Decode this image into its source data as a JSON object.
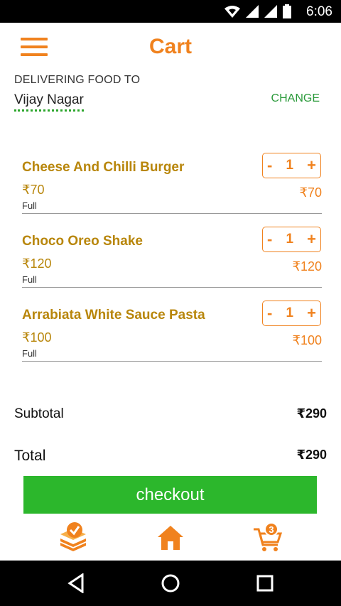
{
  "status_bar": {
    "time": "6:06"
  },
  "header": {
    "title": "Cart"
  },
  "delivery": {
    "label": "DELIVERING FOOD TO",
    "location": "Vijay Nagar",
    "change_label": "CHANGE"
  },
  "cart": {
    "items": [
      {
        "name": "Cheese And Chilli Burger",
        "unit_price": "₹70",
        "size": "Full",
        "quantity": "1",
        "line_total": "₹70"
      },
      {
        "name": "Choco Oreo Shake",
        "unit_price": "₹120",
        "size": "Full",
        "quantity": "1",
        "line_total": "₹120"
      },
      {
        "name": "Arrabiata White Sauce Pasta",
        "unit_price": "₹100",
        "size": "Full",
        "quantity": "1",
        "line_total": "₹100"
      }
    ],
    "stepper": {
      "minus": "-",
      "plus": "+"
    }
  },
  "summary": {
    "subtotal_label": "Subtotal",
    "subtotal_value": "₹290",
    "total_label": "Total",
    "total_value": "₹290"
  },
  "checkout_label": "checkout",
  "tabbar": {
    "orders_icon": "orders-check-icon",
    "home_icon": "home-icon",
    "cart_icon": "cart-icon",
    "cart_badge": "3"
  },
  "colors": {
    "accent": "#f0821e",
    "item_text": "#b8860b",
    "green": "#2cb72c"
  }
}
